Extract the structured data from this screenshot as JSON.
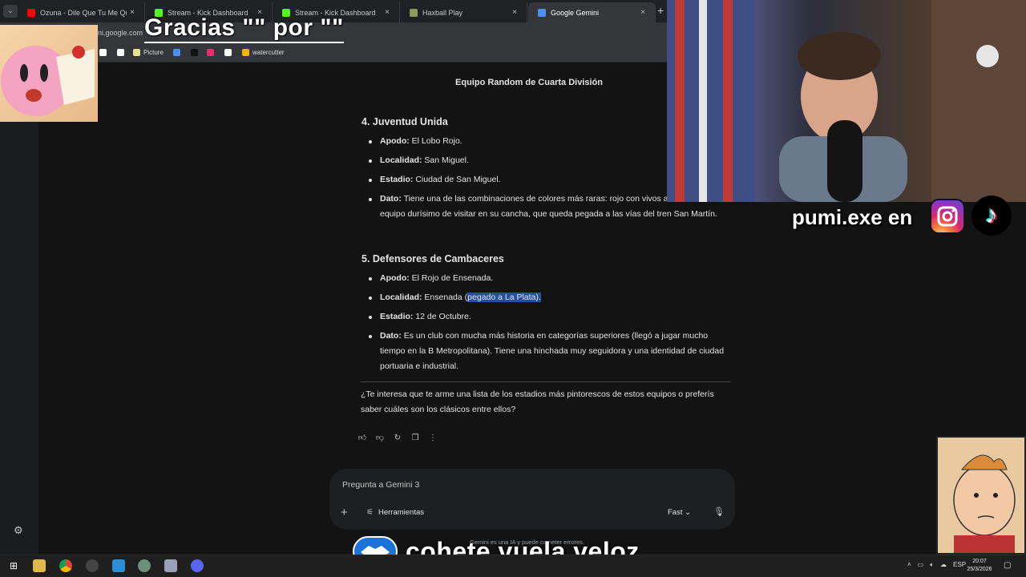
{
  "browser": {
    "tabs": [
      {
        "title": "Ozuna - Dile Que Tu Me Quiere",
        "favicon_color": "#ff0000",
        "active": false
      },
      {
        "title": "Stream - Kick Dashboard",
        "favicon_color": "#53fc18",
        "active": false
      },
      {
        "title": "Stream - Kick Dashboard",
        "favicon_color": "#53fc18",
        "active": false
      },
      {
        "title": "Haxball Play",
        "favicon_color": "#8a9a5b",
        "active": false
      },
      {
        "title": "Google Gemini",
        "favicon_color": "#4c8df6",
        "active": true
      }
    ],
    "new_tab": "+",
    "tab_close": "×",
    "url": "ni.google.com"
  },
  "bookmarks": [
    {
      "label": "",
      "color": "#ffffff"
    },
    {
      "label": "",
      "color": "#ffffff"
    },
    {
      "label": "Picture",
      "color": "#e8e28a"
    },
    {
      "label": "",
      "color": "#4c8df6"
    },
    {
      "label": "",
      "color": "#111111"
    },
    {
      "label": "",
      "color": "#e1306c"
    },
    {
      "label": "",
      "color": "#ffffff"
    },
    {
      "label": "watercutter",
      "color": "#f4b400"
    }
  ],
  "overlays": {
    "gracias": "Gracias \"\" por \"\"",
    "social_handle": "pumi.exe en",
    "banner": "cohete.vuela.veloz"
  },
  "chat": {
    "title": "Equipo Random de Cuarta División",
    "teams": [
      {
        "heading": "4. Juventud Unida",
        "items": [
          {
            "label": "Apodo:",
            "text": " El Lobo Rojo."
          },
          {
            "label": "Localidad:",
            "text": " San Miguel."
          },
          {
            "label": "Estadio:",
            "text": " Ciudad de San Miguel."
          },
          {
            "label": "Dato:",
            "text": " Tiene una de las combinaciones de colores más raras: rojo con vivos azules. Es un equipo durísimo de visitar en su cancha, que queda pegada a las vías del tren San Martín."
          }
        ]
      },
      {
        "heading": "5. Defensores de Cambaceres",
        "items": [
          {
            "label": "Apodo:",
            "text": " El Rojo de Ensenada."
          },
          {
            "label": "Localidad:",
            "text": " Ensenada (",
            "highlight": "pegado a La Plata).",
            "text_after": ""
          },
          {
            "label": "Estadio:",
            "text": " 12 de Octubre."
          },
          {
            "label": "Dato:",
            "text": " Es un club con mucha más historia en categorías superiores (llegó a jugar mucho tiempo en la B Metropolitana). Tiene una hinchada muy seguidora y una identidad de ciudad portuaria e industrial."
          }
        ]
      }
    ],
    "closing": "¿Te interesa que te arme una lista de los estadios más pintorescos de estos equipos o preferís saber cuáles son los clásicos entre ellos?",
    "actions": [
      "thumb-up",
      "thumb-down",
      "regenerate",
      "copy",
      "more"
    ]
  },
  "input": {
    "placeholder": "Pregunta a Gemini 3",
    "tools_label": "Herramientas",
    "mode_label": "Fast ⌄",
    "disclaimer": "Gemini es una IA y puede cometer errores."
  },
  "taskbar": {
    "tray_lang": "ESP",
    "time": "20:07",
    "date": "25/3/2026"
  }
}
